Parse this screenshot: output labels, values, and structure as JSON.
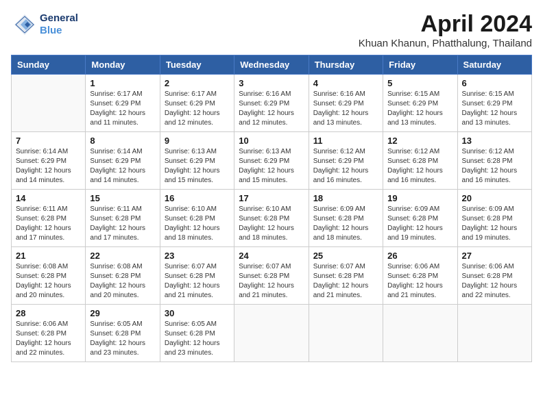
{
  "logo": {
    "line1": "General",
    "line2": "Blue",
    "icon": "▶"
  },
  "title": "April 2024",
  "location": "Khuan Khanun, Phatthalung, Thailand",
  "weekdays": [
    "Sunday",
    "Monday",
    "Tuesday",
    "Wednesday",
    "Thursday",
    "Friday",
    "Saturday"
  ],
  "weeks": [
    [
      {
        "day": "",
        "info": ""
      },
      {
        "day": "1",
        "info": "Sunrise: 6:17 AM\nSunset: 6:29 PM\nDaylight: 12 hours\nand 11 minutes."
      },
      {
        "day": "2",
        "info": "Sunrise: 6:17 AM\nSunset: 6:29 PM\nDaylight: 12 hours\nand 12 minutes."
      },
      {
        "day": "3",
        "info": "Sunrise: 6:16 AM\nSunset: 6:29 PM\nDaylight: 12 hours\nand 12 minutes."
      },
      {
        "day": "4",
        "info": "Sunrise: 6:16 AM\nSunset: 6:29 PM\nDaylight: 12 hours\nand 13 minutes."
      },
      {
        "day": "5",
        "info": "Sunrise: 6:15 AM\nSunset: 6:29 PM\nDaylight: 12 hours\nand 13 minutes."
      },
      {
        "day": "6",
        "info": "Sunrise: 6:15 AM\nSunset: 6:29 PM\nDaylight: 12 hours\nand 13 minutes."
      }
    ],
    [
      {
        "day": "7",
        "info": "Sunrise: 6:14 AM\nSunset: 6:29 PM\nDaylight: 12 hours\nand 14 minutes."
      },
      {
        "day": "8",
        "info": "Sunrise: 6:14 AM\nSunset: 6:29 PM\nDaylight: 12 hours\nand 14 minutes."
      },
      {
        "day": "9",
        "info": "Sunrise: 6:13 AM\nSunset: 6:29 PM\nDaylight: 12 hours\nand 15 minutes."
      },
      {
        "day": "10",
        "info": "Sunrise: 6:13 AM\nSunset: 6:29 PM\nDaylight: 12 hours\nand 15 minutes."
      },
      {
        "day": "11",
        "info": "Sunrise: 6:12 AM\nSunset: 6:29 PM\nDaylight: 12 hours\nand 16 minutes."
      },
      {
        "day": "12",
        "info": "Sunrise: 6:12 AM\nSunset: 6:28 PM\nDaylight: 12 hours\nand 16 minutes."
      },
      {
        "day": "13",
        "info": "Sunrise: 6:12 AM\nSunset: 6:28 PM\nDaylight: 12 hours\nand 16 minutes."
      }
    ],
    [
      {
        "day": "14",
        "info": "Sunrise: 6:11 AM\nSunset: 6:28 PM\nDaylight: 12 hours\nand 17 minutes."
      },
      {
        "day": "15",
        "info": "Sunrise: 6:11 AM\nSunset: 6:28 PM\nDaylight: 12 hours\nand 17 minutes."
      },
      {
        "day": "16",
        "info": "Sunrise: 6:10 AM\nSunset: 6:28 PM\nDaylight: 12 hours\nand 18 minutes."
      },
      {
        "day": "17",
        "info": "Sunrise: 6:10 AM\nSunset: 6:28 PM\nDaylight: 12 hours\nand 18 minutes."
      },
      {
        "day": "18",
        "info": "Sunrise: 6:09 AM\nSunset: 6:28 PM\nDaylight: 12 hours\nand 18 minutes."
      },
      {
        "day": "19",
        "info": "Sunrise: 6:09 AM\nSunset: 6:28 PM\nDaylight: 12 hours\nand 19 minutes."
      },
      {
        "day": "20",
        "info": "Sunrise: 6:09 AM\nSunset: 6:28 PM\nDaylight: 12 hours\nand 19 minutes."
      }
    ],
    [
      {
        "day": "21",
        "info": "Sunrise: 6:08 AM\nSunset: 6:28 PM\nDaylight: 12 hours\nand 20 minutes."
      },
      {
        "day": "22",
        "info": "Sunrise: 6:08 AM\nSunset: 6:28 PM\nDaylight: 12 hours\nand 20 minutes."
      },
      {
        "day": "23",
        "info": "Sunrise: 6:07 AM\nSunset: 6:28 PM\nDaylight: 12 hours\nand 21 minutes."
      },
      {
        "day": "24",
        "info": "Sunrise: 6:07 AM\nSunset: 6:28 PM\nDaylight: 12 hours\nand 21 minutes."
      },
      {
        "day": "25",
        "info": "Sunrise: 6:07 AM\nSunset: 6:28 PM\nDaylight: 12 hours\nand 21 minutes."
      },
      {
        "day": "26",
        "info": "Sunrise: 6:06 AM\nSunset: 6:28 PM\nDaylight: 12 hours\nand 21 minutes."
      },
      {
        "day": "27",
        "info": "Sunrise: 6:06 AM\nSunset: 6:28 PM\nDaylight: 12 hours\nand 22 minutes."
      }
    ],
    [
      {
        "day": "28",
        "info": "Sunrise: 6:06 AM\nSunset: 6:28 PM\nDaylight: 12 hours\nand 22 minutes."
      },
      {
        "day": "29",
        "info": "Sunrise: 6:05 AM\nSunset: 6:28 PM\nDaylight: 12 hours\nand 23 minutes."
      },
      {
        "day": "30",
        "info": "Sunrise: 6:05 AM\nSunset: 6:28 PM\nDaylight: 12 hours\nand 23 minutes."
      },
      {
        "day": "",
        "info": ""
      },
      {
        "day": "",
        "info": ""
      },
      {
        "day": "",
        "info": ""
      },
      {
        "day": "",
        "info": ""
      }
    ]
  ]
}
